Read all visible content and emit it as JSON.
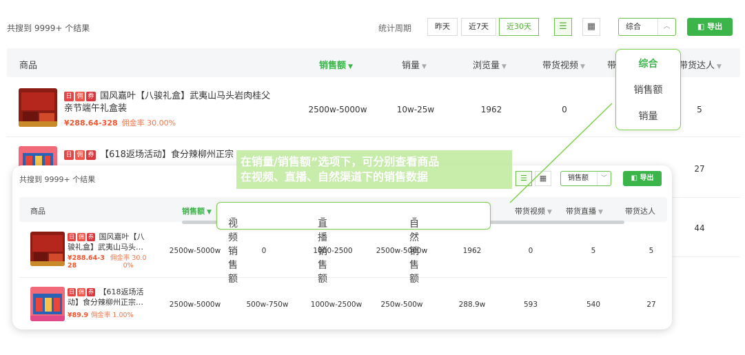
{
  "toolbar": {
    "result_count": "共搜到 9999+ 个结果",
    "period_label": "统计周期",
    "periods": [
      "昨天",
      "近7天",
      "近30天"
    ],
    "sort_value": "综合",
    "export_label": "导出"
  },
  "table": {
    "headers": [
      "商品",
      "销售额",
      "销量",
      "浏览量",
      "带货视频",
      "带货达人"
    ],
    "header_partial": "带",
    "rows": [
      {
        "title": "国风嘉叶【八骏礼盒】武夷山马头岩肉桂父亲节端午礼盒装",
        "title_line1": "国风嘉叶【八骏礼盒】武夷山马头岩肉桂父",
        "title_line2": "亲节端午礼盒装",
        "price": "¥288.64-328",
        "commission": "佣金率 30.00%",
        "sales_amount": "2500w-5000w",
        "sales_volume": "10w-25w",
        "views": "1962",
        "videos": "0",
        "creators": "5"
      },
      {
        "title_line1": "【618返场活动】食分辣柳州正宗",
        "title_line2": "",
        "creators": "27"
      },
      {
        "creators": "44"
      }
    ]
  },
  "dropdown": {
    "options": [
      "综合",
      "销售额",
      "销量"
    ],
    "selected": "综合"
  },
  "callout": {
    "line1": "在销量/销售额”选项下，可分别查看商品",
    "line2": "在视频、直播、自然渠道下的销售数据"
  },
  "card": {
    "result_count": "共搜到 9999+ 个结果",
    "sort_value": "销售额",
    "export_label": "导出",
    "headers": {
      "product": "商品",
      "sales_amount": "销售额",
      "video_sales": "视频销售额",
      "live_sales": "直播销售额",
      "natural_sales": "自然销售额",
      "videos": "带货视频",
      "lives": "带货直播",
      "creators": "带货达人"
    },
    "rows": [
      {
        "title_line1": "国风嘉叶【八",
        "title_line2": "骏礼盒】武夷山马头…",
        "price_line1": "¥288.64-3",
        "price_line2": "28",
        "comm_line1": "佣金率 30.0",
        "comm_line2": "0%",
        "sales_amount": "2500w-5000w",
        "video_sales": "0",
        "live_sales": "1000-2500",
        "natural_sales": "2500w-5000w",
        "col5": "1962",
        "videos": "0",
        "lives": "5",
        "creators": "5"
      },
      {
        "title_line1": "【618返场活",
        "title_line2": "动】食分辣柳州正宗…",
        "price": "¥89.9",
        "commission": "佣金率 1.00%",
        "sales_amount": "2500w-5000w",
        "video_sales": "500w-750w",
        "live_sales": "1000w-2500w",
        "natural_sales": "250w-500w",
        "col5": "288.9w",
        "videos": "593",
        "lives": "540",
        "creators": "27"
      }
    ]
  },
  "tags": [
    "日",
    "佣",
    "券"
  ],
  "colors": {
    "accent": "#3bb54a",
    "price": "#f0552f",
    "commission": "#f4764a",
    "outline": "#7dd04a"
  }
}
